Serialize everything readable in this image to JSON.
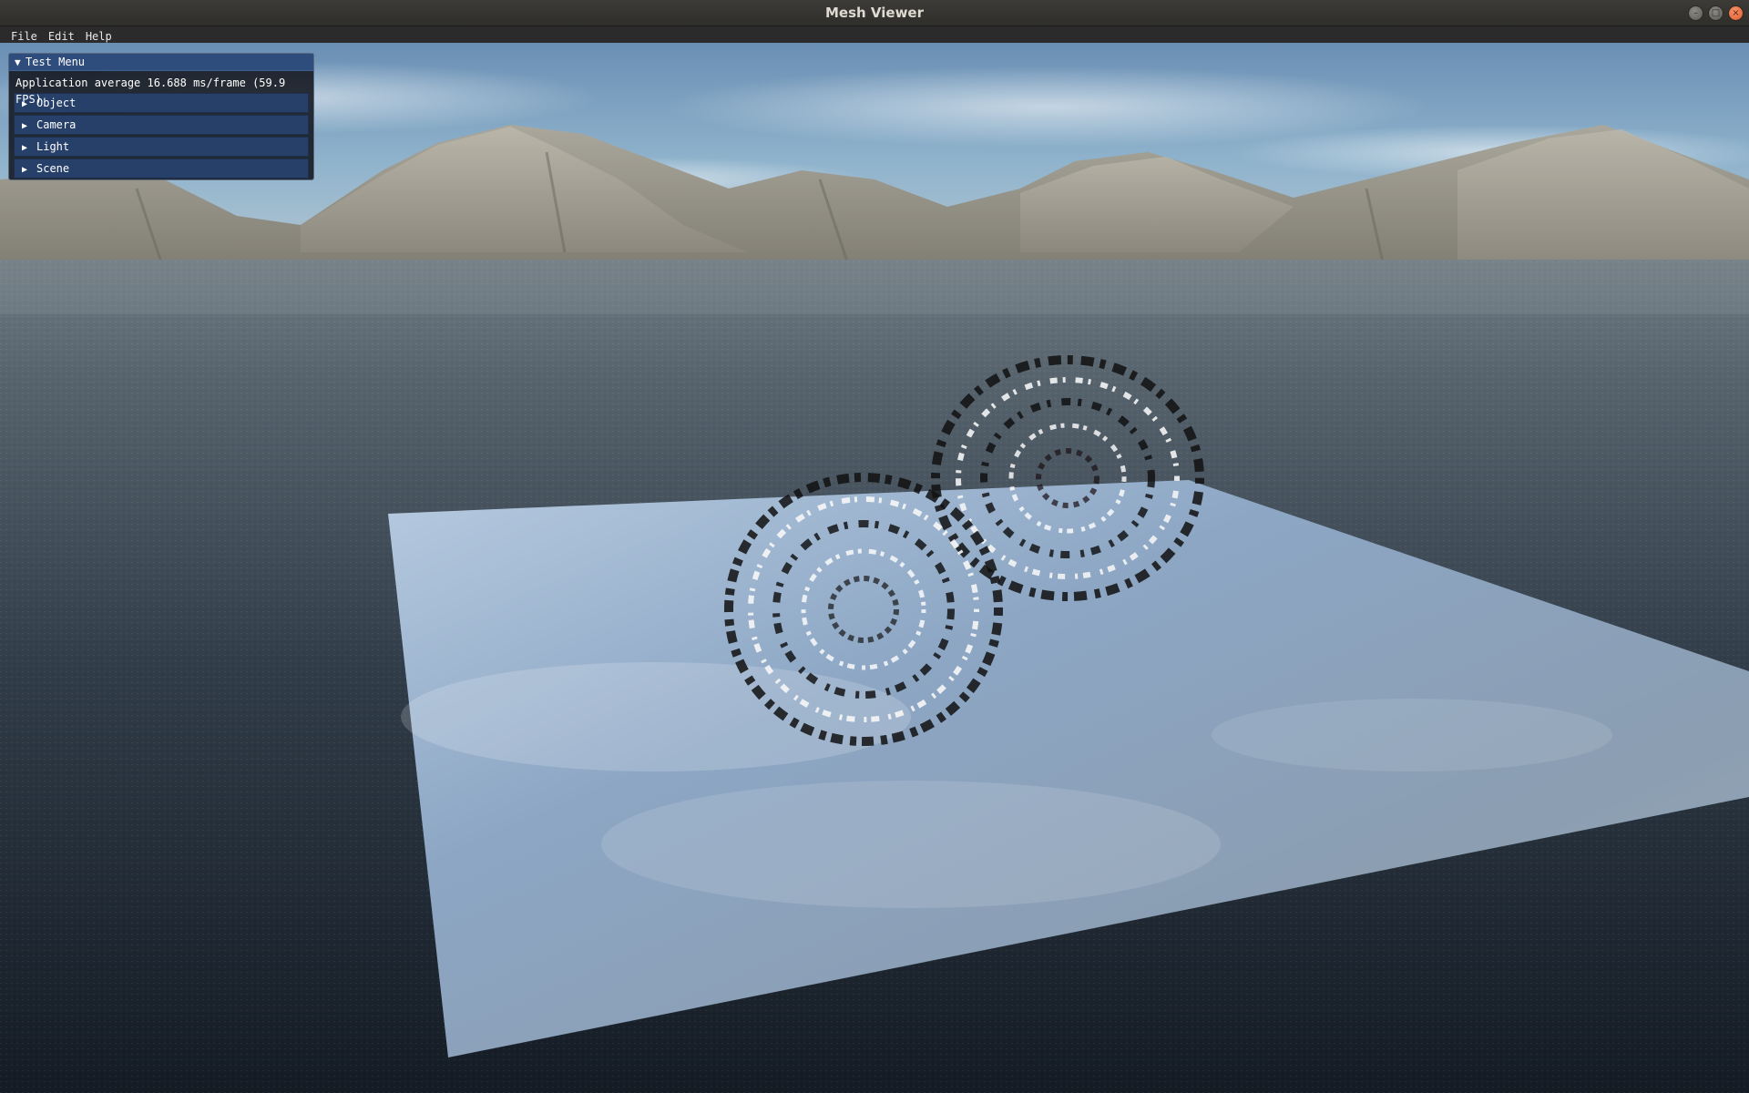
{
  "window": {
    "title": "Mesh Viewer",
    "controls": {
      "minimize_icon": "–",
      "maximize_icon": "□",
      "close_icon": "×"
    }
  },
  "menubar": {
    "items": [
      "File",
      "Edit",
      "Help"
    ]
  },
  "test_menu": {
    "title": "Test Menu",
    "collapse_icon": "▼",
    "fps_text": "Application average 16.688 ms/frame (59.9 FPS)",
    "expand_icon": "▶",
    "headers": [
      "Object",
      "Camera",
      "Light",
      "Scene"
    ]
  },
  "colors": {
    "imgui_title": "#2e4c7c",
    "imgui_header": "#26406a",
    "close_button": "#e15b2a"
  }
}
